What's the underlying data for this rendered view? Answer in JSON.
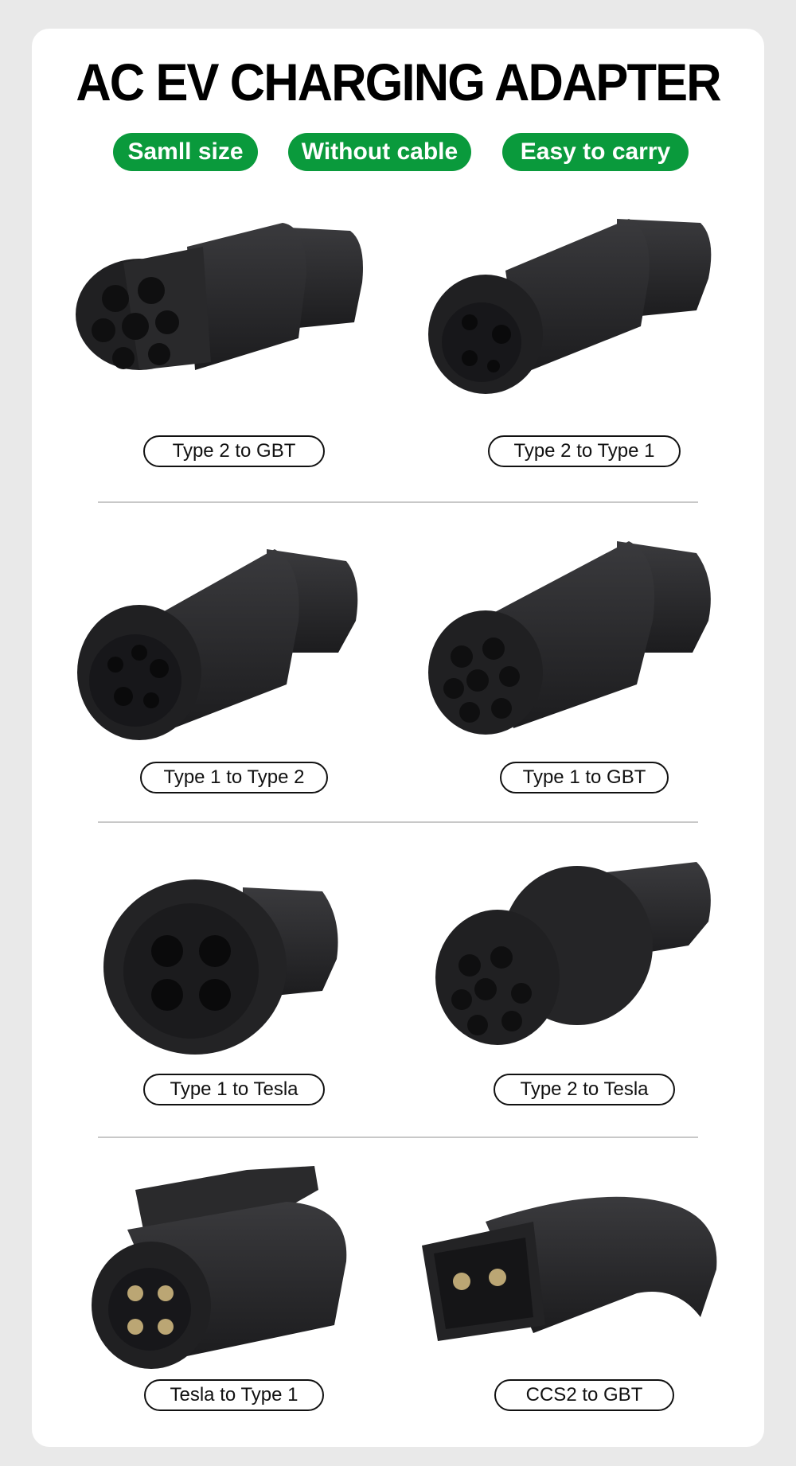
{
  "title": "AC EV CHARGING ADAPTER",
  "features": [
    "Samll size",
    "Without cable",
    "Easy to carry"
  ],
  "colors": {
    "accent": "#0a9a3c",
    "product": "#2b2b2d",
    "background": "#e9e9e9"
  },
  "products": [
    {
      "label": "Type 2 to GBT"
    },
    {
      "label": "Type 2 to Type 1"
    },
    {
      "label": "Type 1 to Type 2"
    },
    {
      "label": "Type 1 to GBT"
    },
    {
      "label": "Type 1 to Tesla"
    },
    {
      "label": "Type 2 to Tesla"
    },
    {
      "label": "Tesla to Type 1"
    },
    {
      "label": "CCS2 to GBT"
    }
  ]
}
